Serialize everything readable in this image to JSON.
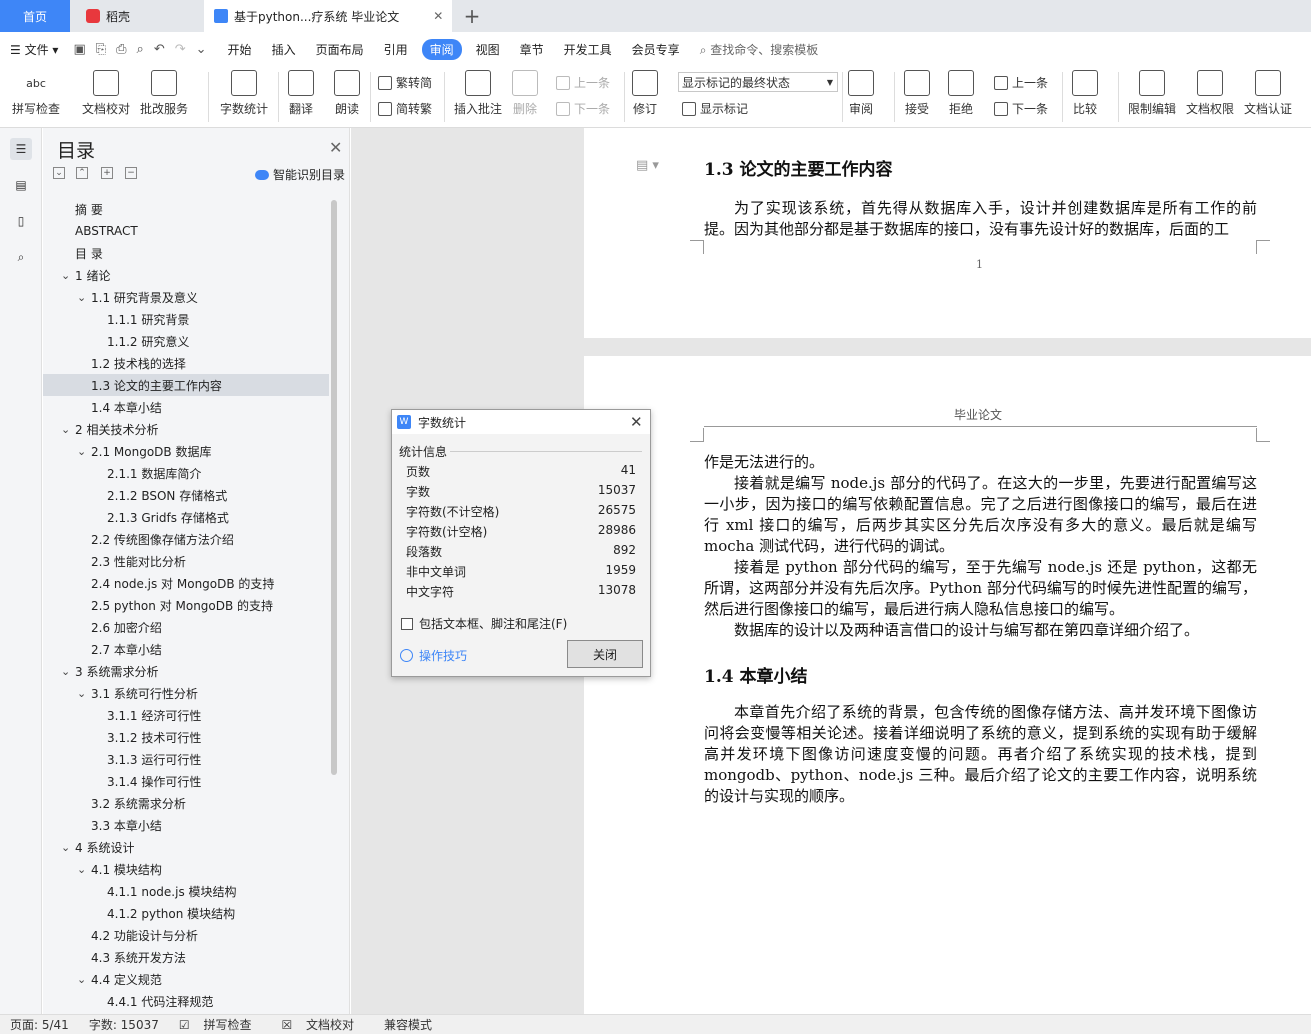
{
  "tabs": {
    "home": "首页",
    "daoke": "稻壳",
    "doc": "基于python...疗系统 毕业论文"
  },
  "menu": {
    "file": "文件",
    "items": [
      "开始",
      "插入",
      "页面布局",
      "引用",
      "审阅",
      "视图",
      "章节",
      "开发工具",
      "会员专享"
    ],
    "active": "审阅",
    "search": "查找命令、搜索模板"
  },
  "ribbon": {
    "spell": "拼写检查",
    "proof": "文档校对",
    "annotate_service": "批改服务",
    "word_count": "字数统计",
    "translate": "翻译",
    "read_aloud": "朗读",
    "trad_simp": "繁转简",
    "simp_trad": "简转繁",
    "insert_comment": "插入批注",
    "delete": "删除",
    "prev": "上一条",
    "next": "下一条",
    "revise": "修订",
    "markup_select": "显示标记的最终状态",
    "show_markup": "显示标记",
    "review": "审阅",
    "accept": "接受",
    "reject": "拒绝",
    "prev2": "上一条",
    "next2": "下一条",
    "compare": "比较",
    "restrict": "限制编辑",
    "permission": "文档权限",
    "certify": "文档认证",
    "icon_abc": "abc"
  },
  "toc": {
    "title": "目录",
    "smart": "智能识别目录",
    "items": [
      {
        "t": "摘  要",
        "lvl": 0
      },
      {
        "t": "ABSTRACT",
        "lvl": 0
      },
      {
        "t": "目  录",
        "lvl": 0
      },
      {
        "t": "1  绪论",
        "lvl": 1,
        "chev": true
      },
      {
        "t": "1.1  研究背景及意义",
        "lvl": 2,
        "chev": true
      },
      {
        "t": "1.1.1  研究背景",
        "lvl": 3
      },
      {
        "t": "1.1.2  研究意义",
        "lvl": 3
      },
      {
        "t": "1.2  技术栈的选择",
        "lvl": 2
      },
      {
        "t": "1.3  论文的主要工作内容",
        "lvl": 2,
        "sel": true
      },
      {
        "t": "1.4  本章小结",
        "lvl": 2
      },
      {
        "t": "2  相关技术分析",
        "lvl": 1,
        "chev": true
      },
      {
        "t": "2.1 MongoDB 数据库",
        "lvl": 2,
        "chev": true
      },
      {
        "t": "2.1.1  数据库简介",
        "lvl": 3
      },
      {
        "t": "2.1.2 BSON 存储格式",
        "lvl": 3
      },
      {
        "t": "2.1.3 Gridfs 存储格式",
        "lvl": 3
      },
      {
        "t": "2.2  传统图像存储方法介绍",
        "lvl": 2
      },
      {
        "t": "2.3  性能对比分析",
        "lvl": 2
      },
      {
        "t": "2.4 node.js 对 MongoDB 的支持",
        "lvl": 2
      },
      {
        "t": "2.5 python 对 MongoDB 的支持",
        "lvl": 2
      },
      {
        "t": "2.6  加密介绍",
        "lvl": 2
      },
      {
        "t": "2.7  本章小结",
        "lvl": 2
      },
      {
        "t": "3  系统需求分析",
        "lvl": 1,
        "chev": true
      },
      {
        "t": "3.1  系统可行性分析",
        "lvl": 2,
        "chev": true
      },
      {
        "t": "3.1.1  经济可行性",
        "lvl": 3
      },
      {
        "t": "3.1.2  技术可行性",
        "lvl": 3
      },
      {
        "t": "3.1.3  运行可行性",
        "lvl": 3
      },
      {
        "t": "3.1.4  操作可行性",
        "lvl": 3
      },
      {
        "t": "3.2  系统需求分析",
        "lvl": 2
      },
      {
        "t": "3.3  本章小结",
        "lvl": 2
      },
      {
        "t": "4  系统设计",
        "lvl": 1,
        "chev": true
      },
      {
        "t": "4.1  模块结构",
        "lvl": 2,
        "chev": true
      },
      {
        "t": "4.1.1 node.js 模块结构",
        "lvl": 3
      },
      {
        "t": "4.1.2 python 模块结构",
        "lvl": 3
      },
      {
        "t": "4.2 功能设计与分析",
        "lvl": 2
      },
      {
        "t": "4.3  系统开发方法",
        "lvl": 2
      },
      {
        "t": "4.4  定义规范",
        "lvl": 2,
        "chev": true
      },
      {
        "t": "4.4.1  代码注释规范",
        "lvl": 3
      }
    ]
  },
  "doc": {
    "p1_heading": "1.3  论文的主要工作内容",
    "p1_para": "为了实现该系统，首先得从数据库入手，设计并创建数据库是所有工作的前提。因为其他部分都是基于数据库的接口，没有事先设计好的数据库，后面的工",
    "page_number": "1",
    "header": "毕业论文",
    "p2_line": "作是无法进行的。",
    "p2_para1": "接着就是编写 node.js 部分的代码了。在这大的一步里，先要进行配置编写这一小步，因为接口的编写依赖配置信息。完了之后进行图像接口的编写，最后在进行 xml 接口的编写，后两步其实区分先后次序没有多大的意义。最后就是编写 mocha 测试代码，进行代码的调试。",
    "p2_para2": "接着是 python 部分代码的编写，至于先编写 node.js 还是 python，这都无所谓，这两部分并没有先后次序。Python 部分代码编写的时候先进性配置的编写，然后进行图像接口的编写，最后进行病人隐私信息接口的编写。",
    "p2_para3": "数据库的设计以及两种语言借口的设计与编写都在第四章详细介绍了。",
    "p2_heading": "1.4  本章小结",
    "p2_para4": "本章首先介绍了系统的背景，包含传统的图像存储方法、高并发环境下图像访问将会变慢等相关论述。接着详细说明了系统的意义，提到系统的实现有助于缓解高并发环境下图像访问速度变慢的问题。再者介绍了系统实现的技术栈，提到 mongodb、python、node.js 三种。最后介绍了论文的主要工作内容，说明系统的设计与实现的顺序。"
  },
  "dialog": {
    "title": "字数统计",
    "section": "统计信息",
    "stats": [
      {
        "label": "页数",
        "value": "41"
      },
      {
        "label": "字数",
        "value": "15037"
      },
      {
        "label": "字符数(不计空格)",
        "value": "26575"
      },
      {
        "label": "字符数(计空格)",
        "value": "28986"
      },
      {
        "label": "段落数",
        "value": "892"
      },
      {
        "label": "非中文单词",
        "value": "1959"
      },
      {
        "label": "中文字符",
        "value": "13078"
      }
    ],
    "checkbox": "包括文本框、脚注和尾注(F)",
    "tips": "操作技巧",
    "close": "关闭",
    "logo": "W"
  },
  "status": {
    "page": "页面: 5/41",
    "words": "字数: 15037",
    "spell": "拼写检查",
    "proof": "文档校对",
    "compat": "兼容模式"
  }
}
